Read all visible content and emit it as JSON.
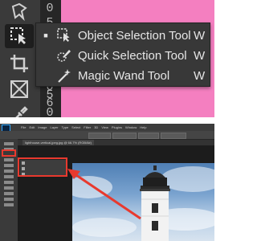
{
  "flyout": {
    "items": [
      {
        "label": "Object Selection Tool",
        "shortcut": "W",
        "icon": "object-selection-icon",
        "selected": true
      },
      {
        "label": "Quick Selection Tool",
        "shortcut": "W",
        "icon": "quick-selection-icon",
        "selected": false
      },
      {
        "label": "Magic Wand Tool",
        "shortcut": "W",
        "icon": "magic-wand-icon",
        "selected": false
      }
    ]
  },
  "ruler": {
    "digits": [
      "0",
      "5",
      "0",
      "5",
      "6",
      "0"
    ]
  },
  "colors": {
    "background_pink": "#f47fc0",
    "toolbar_dark": "#3a3a3a",
    "highlight_red": "#e8392e"
  },
  "bottom": {
    "menu_items": [
      "File",
      "Edit",
      "Image",
      "Layer",
      "Type",
      "Select",
      "Filter",
      "3D",
      "View",
      "Plugins",
      "Window",
      "Help"
    ],
    "tab_label": "lighthouse-vertical.jpeg.jpg @ 66.7% (RGB/8#)"
  }
}
